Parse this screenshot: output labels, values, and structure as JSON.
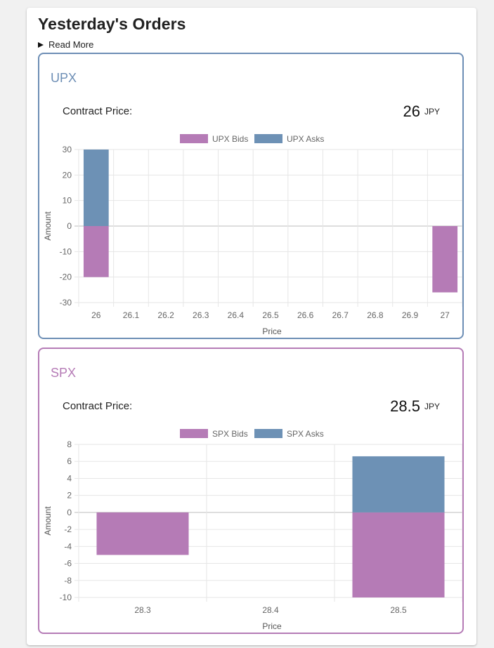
{
  "page": {
    "title": "Yesterday's Orders",
    "read_more": "Read More"
  },
  "colors": {
    "bids": "#b57bb6",
    "asks": "#6d91b5",
    "upx_border": "#6d8eb5",
    "spx_border": "#b57bb6"
  },
  "panels": [
    {
      "name": "UPX",
      "contract_price_label": "Contract Price:",
      "contract_price": "26",
      "currency": "JPY",
      "chart_data": {
        "type": "bar",
        "stacked": true,
        "categories": [
          "26",
          "26.1",
          "26.2",
          "26.3",
          "26.4",
          "26.5",
          "26.6",
          "26.7",
          "26.8",
          "26.9",
          "27"
        ],
        "series": [
          {
            "name": "UPX Bids",
            "values": [
              -20,
              0,
              0,
              0,
              0,
              0,
              0,
              0,
              0,
              0,
              -26
            ]
          },
          {
            "name": "UPX Asks",
            "values": [
              30,
              0,
              0,
              0,
              0,
              0,
              0,
              0,
              0,
              0,
              0
            ]
          }
        ],
        "yticks": [
          30,
          20,
          10,
          0,
          -10,
          -20,
          -30
        ],
        "ylim": [
          -30,
          30
        ],
        "xlabel": "Price",
        "ylabel": "Amount",
        "grid": true,
        "legend": "top-center"
      }
    },
    {
      "name": "SPX",
      "contract_price_label": "Contract Price:",
      "contract_price": "28.5",
      "currency": "JPY",
      "chart_data": {
        "type": "bar",
        "stacked": true,
        "categories": [
          "28.3",
          "28.4",
          "28.5"
        ],
        "series": [
          {
            "name": "SPX Bids",
            "values": [
              -5,
              0,
              -10
            ]
          },
          {
            "name": "SPX Asks",
            "values": [
              0,
              0,
              6.6
            ]
          }
        ],
        "yticks": [
          8,
          6,
          4,
          2,
          0,
          -2,
          -4,
          -6,
          -8,
          -10
        ],
        "ylim": [
          -10,
          8
        ],
        "xlabel": "Price",
        "ylabel": "Amount",
        "grid": true,
        "legend": "top-center"
      }
    }
  ]
}
